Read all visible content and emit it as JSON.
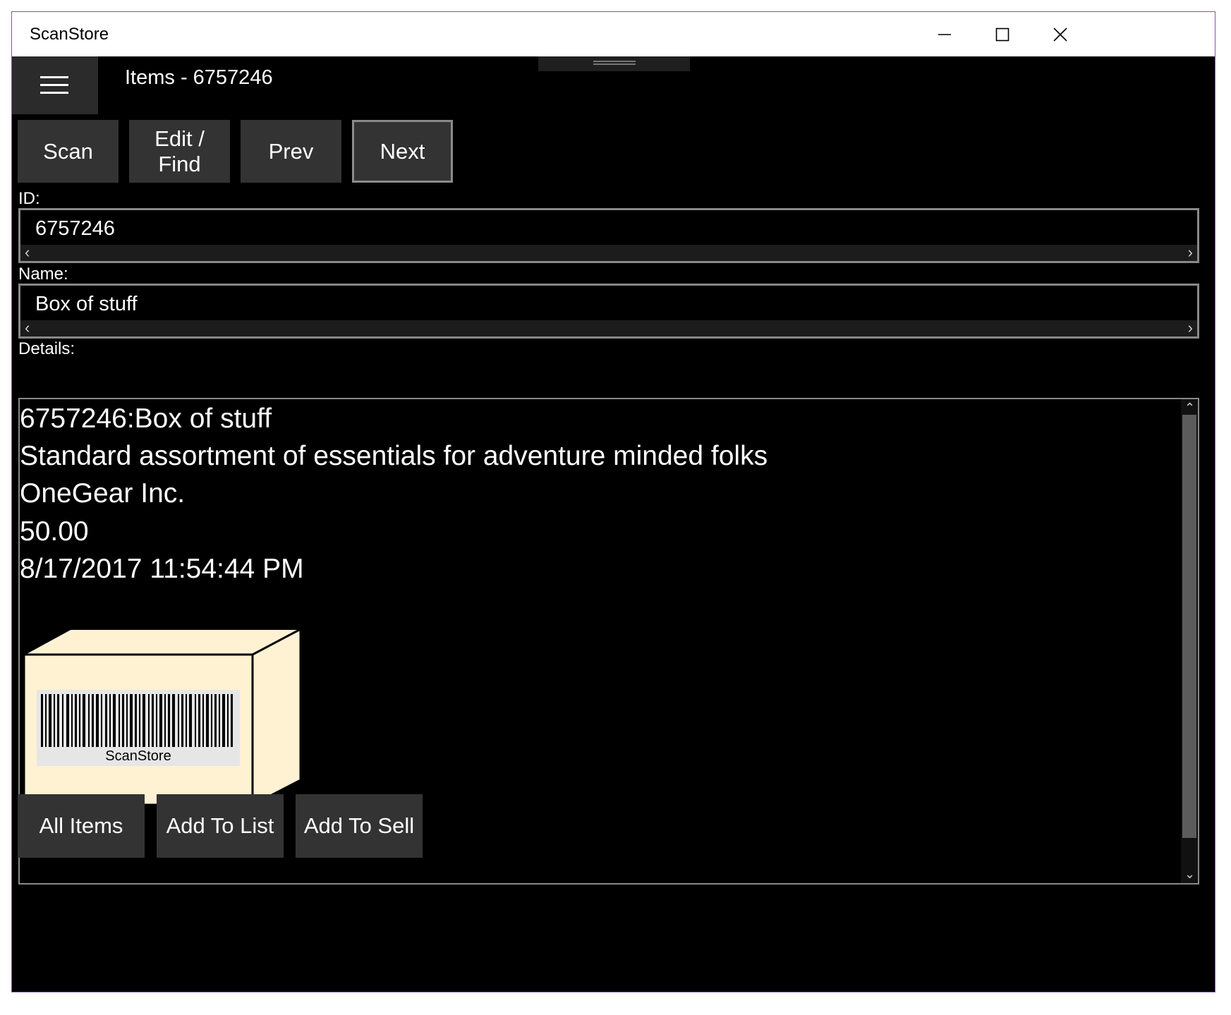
{
  "window": {
    "title": "ScanStore",
    "controls": [
      "minimize-icon",
      "maximize-icon",
      "close-icon"
    ]
  },
  "header": {
    "menu_icon": "hamburger-menu-icon",
    "title": "Items - 6757246"
  },
  "toolbar": {
    "scan_label": "Scan",
    "edit_find_line1": "Edit /",
    "edit_find_line2": "Find",
    "prev_label": "Prev",
    "next_label": "Next"
  },
  "fields": {
    "id_label": "ID:",
    "id_value": "6757246",
    "name_label": "Name:",
    "name_value": "Box of stuff",
    "details_label": "Details:"
  },
  "details": {
    "lines": [
      "6757246:Box of stuff",
      "Standard assortment of essentials for adventure minded folks",
      "OneGear Inc.",
      "50.00",
      "8/17/2017 11:54:44 PM"
    ],
    "image_label": "ScanStore"
  },
  "actions": {
    "all_items": "All Items",
    "add_to_list": "Add To List",
    "add_to_sell": "Add To Sell"
  },
  "colors": {
    "background": "#000000",
    "button": "#333333",
    "box_face": "#fff2d3",
    "window_border": "#7d5aa6"
  }
}
